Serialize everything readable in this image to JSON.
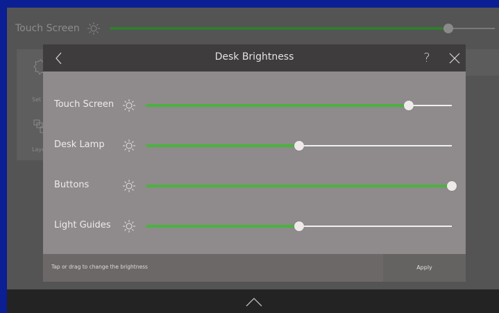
{
  "background": {
    "title": "Touch Screen",
    "level": 0.88,
    "menu": [
      {
        "label": "Set",
        "icon": "settings-icon"
      },
      {
        "label": "Layou",
        "icon": "layout-icon"
      }
    ]
  },
  "dialog": {
    "title": "Desk Brightness",
    "help_label": "?",
    "rows": [
      {
        "label": "Touch Screen",
        "value": 0.86
      },
      {
        "label": "Desk Lamp",
        "value": 0.5
      },
      {
        "label": "Buttons",
        "value": 1.0
      },
      {
        "label": "Light Guides",
        "value": 0.5
      }
    ],
    "hint": "Tap or drag to change the brightness",
    "apply_label": "Apply"
  },
  "colors": {
    "accent": "#49b33e",
    "frame": "#0b1e93"
  }
}
